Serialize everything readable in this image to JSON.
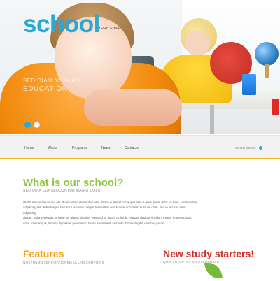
{
  "hero": {
    "logo": "school",
    "logo_subtitle": "YOUR CHILD",
    "tagline_line1": "SED DIAM NONUMY",
    "tagline_line2": "EDUCATION"
  },
  "slider": {
    "active_index": 1,
    "count": 2
  },
  "nav": {
    "items": [
      "Home",
      "About",
      "Programs",
      "News",
      "Contacts"
    ],
    "search_label": "SEND SEND"
  },
  "about": {
    "title": "What is our school?",
    "subtitle": "SED QUIA CONSEQUUNTUR MAGNI DOLO",
    "paragraph_lines": [
      "Vestibulum iaculis lacinia est. Proin dictum elementum velit. Fusce euismod consequat ante. Lorem ipsum dolor sit amet, consectetuer",
      "adipiscing elit. Pellentesque sed dolor. Aliquam congue fermentum nisl. Mauris accumsan nulla vel diam. Sed in lacus ut enim adipiscing",
      "aliquet. Nulla venenatis. In pede mi, aliquet sit amet, euismod in, auctor ut, ligula. Aliquam dapibus tincidunt metus. Praesent justo",
      "dolor, lobortis quis, lobortis dignissim, pulvinar ac, lorem. Vestibulum sed ante. Donec sagittis euismod purus."
    ],
    "colors": {
      "title": "#8dc63f"
    }
  },
  "features": {
    "title": "Features",
    "subtitle": "NOSTRUM EXERCITATIONEM ULLAM CORPORIS",
    "colors": {
      "title": "#f6a21c"
    }
  },
  "new_study": {
    "title": "New study starters!",
    "subtitle": "QUIA VOLUPTAS SIT ASPERNATU",
    "colors": {
      "title": "#d02b27"
    }
  },
  "theme": {
    "accent": "#29a9d6",
    "nav_underline": "#f6b21f"
  }
}
